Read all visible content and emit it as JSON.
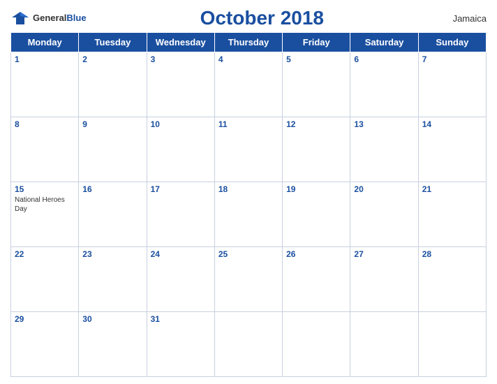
{
  "header": {
    "logo_general": "General",
    "logo_blue": "Blue",
    "title": "October 2018",
    "country": "Jamaica"
  },
  "weekdays": [
    "Monday",
    "Tuesday",
    "Wednesday",
    "Thursday",
    "Friday",
    "Saturday",
    "Sunday"
  ],
  "weeks": [
    [
      {
        "day": "1",
        "holiday": ""
      },
      {
        "day": "2",
        "holiday": ""
      },
      {
        "day": "3",
        "holiday": ""
      },
      {
        "day": "4",
        "holiday": ""
      },
      {
        "day": "5",
        "holiday": ""
      },
      {
        "day": "6",
        "holiday": ""
      },
      {
        "day": "7",
        "holiday": ""
      }
    ],
    [
      {
        "day": "8",
        "holiday": ""
      },
      {
        "day": "9",
        "holiday": ""
      },
      {
        "day": "10",
        "holiday": ""
      },
      {
        "day": "11",
        "holiday": ""
      },
      {
        "day": "12",
        "holiday": ""
      },
      {
        "day": "13",
        "holiday": ""
      },
      {
        "day": "14",
        "holiday": ""
      }
    ],
    [
      {
        "day": "15",
        "holiday": "National Heroes Day"
      },
      {
        "day": "16",
        "holiday": ""
      },
      {
        "day": "17",
        "holiday": ""
      },
      {
        "day": "18",
        "holiday": ""
      },
      {
        "day": "19",
        "holiday": ""
      },
      {
        "day": "20",
        "holiday": ""
      },
      {
        "day": "21",
        "holiday": ""
      }
    ],
    [
      {
        "day": "22",
        "holiday": ""
      },
      {
        "day": "23",
        "holiday": ""
      },
      {
        "day": "24",
        "holiday": ""
      },
      {
        "day": "25",
        "holiday": ""
      },
      {
        "day": "26",
        "holiday": ""
      },
      {
        "day": "27",
        "holiday": ""
      },
      {
        "day": "28",
        "holiday": ""
      }
    ],
    [
      {
        "day": "29",
        "holiday": ""
      },
      {
        "day": "30",
        "holiday": ""
      },
      {
        "day": "31",
        "holiday": ""
      },
      {
        "day": "",
        "holiday": ""
      },
      {
        "day": "",
        "holiday": ""
      },
      {
        "day": "",
        "holiday": ""
      },
      {
        "day": "",
        "holiday": ""
      }
    ]
  ]
}
